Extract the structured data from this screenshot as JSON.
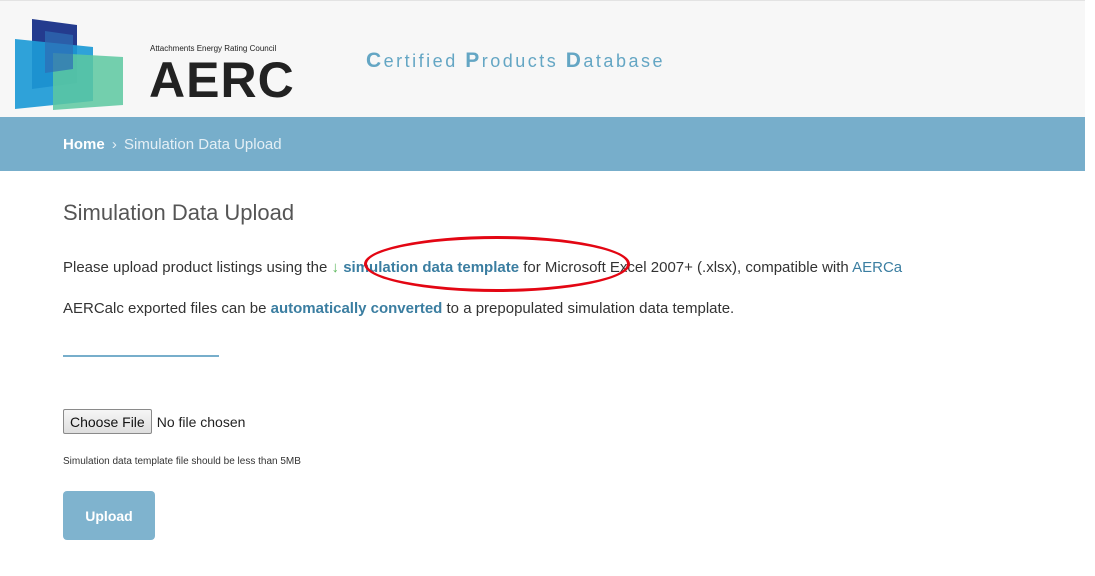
{
  "logo": {
    "tagline": "Attachments Energy Rating Council",
    "wordmark": "AERC"
  },
  "site_title": [
    {
      "cap": "C",
      "rest": "ertified "
    },
    {
      "cap": "P",
      "rest": "roducts "
    },
    {
      "cap": "D",
      "rest": "atabase"
    }
  ],
  "breadcrumb": {
    "home": "Home",
    "separator": "›",
    "current": "Simulation Data Upload"
  },
  "page": {
    "title": "Simulation Data Upload",
    "line1_before": "Please upload product listings using the ",
    "template_icon": "↓",
    "template_link": "simulation data template",
    "line1_after": " for Microsoft Excel 2007+ (.xlsx), compatible with ",
    "aercalc_link": "AERCa",
    "line2_before": "AERCalc exported files can be ",
    "convert_link": "automatically converted",
    "line2_after": " to a prepopulated simulation data template."
  },
  "file_input": {
    "button_label": "Choose File",
    "status": "No file chosen"
  },
  "hint": "Simulation data template file should be less than 5MB",
  "upload_label": "Upload",
  "colors": {
    "brand_blue": "#64a6c4",
    "breadcrumb_bar": "#77aecb",
    "link": "#3b7ea1",
    "annotation_red": "#e30613"
  },
  "icons": {
    "template_download": "download-icon"
  }
}
